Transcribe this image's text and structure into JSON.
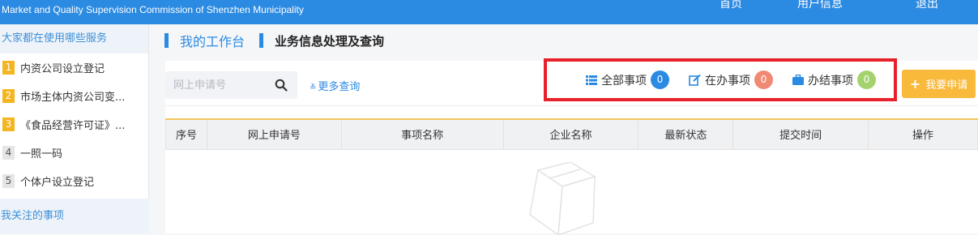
{
  "header": {
    "subtitle": "Market and Quality Supervision Commission of Shenzhen Municipality",
    "nav": [
      "首页",
      "用户信息",
      "退出"
    ]
  },
  "sidebar": {
    "heading": "大家都在使用哪些服务",
    "items": [
      {
        "num": "1",
        "label": "内资公司设立登记",
        "hot": true
      },
      {
        "num": "2",
        "label": "市场主体内资公司变...",
        "hot": true
      },
      {
        "num": "3",
        "label": "《食品经营许可证》...",
        "hot": true
      },
      {
        "num": "4",
        "label": "一照一码",
        "hot": false
      },
      {
        "num": "5",
        "label": "个体户设立登记",
        "hot": false
      }
    ],
    "footer": "我关注的事项"
  },
  "breadcrumb": {
    "first": "我的工作台",
    "second": "业务信息处理及查询"
  },
  "search": {
    "placeholder": "网上申请号",
    "more_label": "更多查询"
  },
  "status_filters": [
    {
      "label": "全部事项",
      "count": "0",
      "color": "#2b8ae2",
      "icon": "list-icon"
    },
    {
      "label": "在办事项",
      "count": "0",
      "color": "#f08a74",
      "icon": "edit-icon"
    },
    {
      "label": "办结事项",
      "count": "0",
      "color": "#a4d26c",
      "icon": "briefcase-icon"
    }
  ],
  "apply_button": "我要申请",
  "table": {
    "columns": [
      "序号",
      "网上申请号",
      "事项名称",
      "企业名称",
      "最新状态",
      "提交时间",
      "操作"
    ]
  },
  "colors": {
    "primary": "#2b8ae2",
    "accent": "#f9b93a",
    "highlight_border": "#e8202a"
  }
}
